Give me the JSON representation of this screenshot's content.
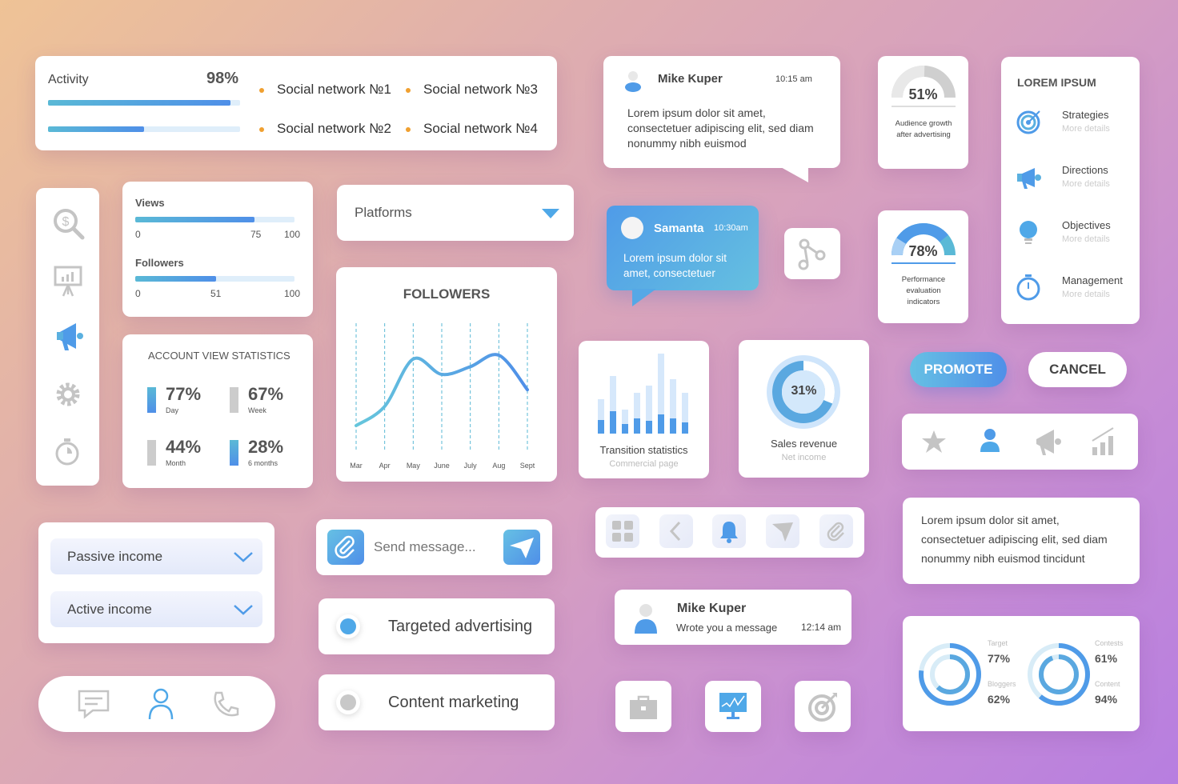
{
  "colors": {
    "accent": "#4f9be8",
    "orange_dot": "#f0a030",
    "gray_icon": "#c4c4c4"
  },
  "activity": {
    "label": "Activity",
    "value": "98%",
    "bars": [
      0.95,
      0.5
    ],
    "networks": [
      "Social network №1",
      "Social network №2",
      "Social network №3",
      "Social network №4"
    ]
  },
  "sidebar": {
    "icons": [
      "money-search-icon",
      "presentation-icon",
      "megaphone-icon",
      "gear-icon",
      "stopwatch-icon"
    ],
    "active": 2
  },
  "progress": {
    "views": {
      "label": "Views",
      "value": 75,
      "min": "0",
      "mid": "75",
      "max": "100"
    },
    "followers": {
      "label": "Followers",
      "value": 51,
      "min": "0",
      "mid": "51",
      "max": "100"
    }
  },
  "account_stats": {
    "title": "ACCOUNT VIEW STATISTICS",
    "items": [
      {
        "value": "77%",
        "label": "Day",
        "active": true
      },
      {
        "value": "67%",
        "label": "Week",
        "active": false
      },
      {
        "value": "44%",
        "label": "Month",
        "active": false
      },
      {
        "value": "28%",
        "label": "6 months",
        "active": true
      }
    ]
  },
  "platforms": {
    "label": "Platforms"
  },
  "chart_data": {
    "type": "line",
    "title": "FOLLOWERS",
    "categories": [
      "Mar",
      "Apr",
      "May",
      "June",
      "July",
      "Aug",
      "Sept"
    ],
    "values": [
      20,
      35,
      72,
      60,
      66,
      75,
      48
    ],
    "grid": "vertical-dashed",
    "xlabel": "",
    "ylabel": ""
  },
  "chat1": {
    "name": "Mike Kuper",
    "time": "10:15 am",
    "text": "Lorem ipsum dolor sit amet, consectetuer adipiscing elit, sed diam nonummy nibh euismod"
  },
  "chat2": {
    "name": "Samanta",
    "time": "10:30am",
    "text": "Lorem ipsum dolor sit amet, consectetuer"
  },
  "gauge1": {
    "value": "51%",
    "fraction": 0.51,
    "caption": "Audience growth after advertising"
  },
  "gauge2": {
    "value": "78%",
    "fraction": 0.78,
    "caption": "Performance evaluation indicators"
  },
  "lorem_list": {
    "title": "LOREM IPSUM",
    "items": [
      {
        "label": "Strategies",
        "sub": "More details",
        "icon": "target-icon"
      },
      {
        "label": "Directions",
        "sub": "More details",
        "icon": "megaphone-icon"
      },
      {
        "label": "Objectives",
        "sub": "More details",
        "icon": "lightbulb-icon"
      },
      {
        "label": "Management",
        "sub": "More details",
        "icon": "stopwatch-icon"
      }
    ]
  },
  "transition": {
    "title": "Transition statistics",
    "sub": "Commercial page",
    "totals": [
      43,
      72,
      30,
      51,
      60,
      100,
      68,
      51
    ],
    "parts": [
      17,
      28,
      12,
      19,
      16,
      24,
      19,
      14
    ]
  },
  "sales": {
    "value": "31%",
    "fraction": 0.31,
    "title": "Sales revenue",
    "sub": "Net income"
  },
  "buttons": {
    "promote": "PROMOTE",
    "cancel": "CANCEL"
  },
  "income": {
    "options": [
      "Passive income",
      "Active income"
    ]
  },
  "send": {
    "placeholder": "Send message..."
  },
  "radios": [
    {
      "label": "Targeted advertising",
      "selected": true
    },
    {
      "label": "Content marketing",
      "selected": false
    }
  ],
  "notification": {
    "name": "Mike Kuper",
    "text": "Wrote you a message",
    "time": "12:14 am"
  },
  "text_card": "Lorem ipsum dolor sit amet, consectetuer adipiscing elit, sed diam nonummy nibh euismod tincidunt",
  "donuts": [
    {
      "outer_label": "Target",
      "outer": "77%",
      "outer_f": 0.77,
      "inner_label": "Bloggers",
      "inner": "62%",
      "inner_f": 0.62
    },
    {
      "outer_label": "Contests",
      "outer": "61%",
      "outer_f": 0.61,
      "inner_label": "Content",
      "inner": "94%",
      "inner_f": 0.94
    }
  ]
}
